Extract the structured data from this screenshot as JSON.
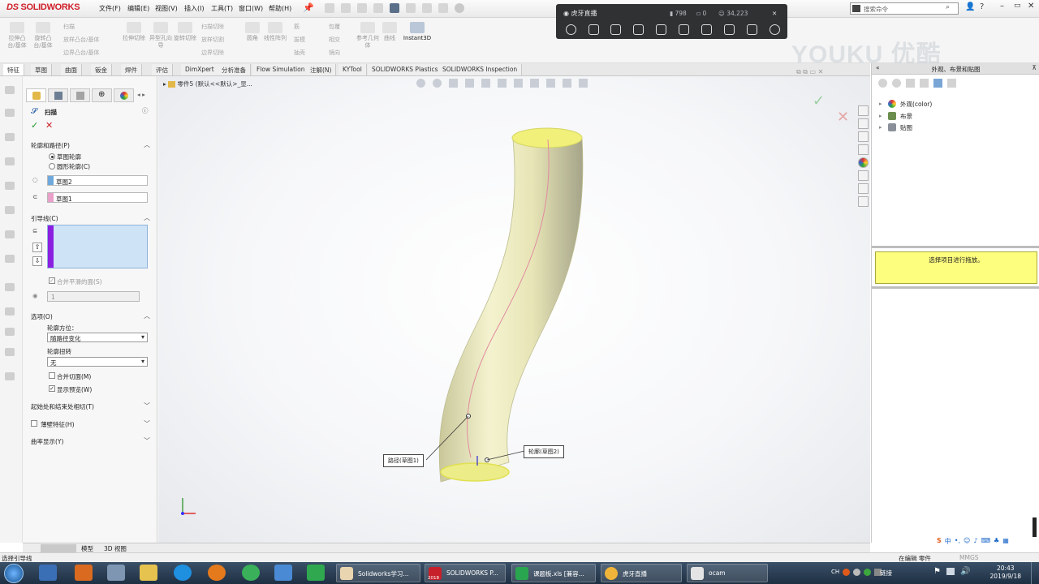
{
  "app": {
    "logo_prefix": "DS",
    "logo_name": "SOLIDWORKS"
  },
  "menu": [
    "文件(F)",
    "编辑(E)",
    "视图(V)",
    "插入(I)",
    "工具(T)",
    "窗口(W)",
    "帮助(H)"
  ],
  "search": {
    "placeholder": "搜索命令"
  },
  "ribbon": {
    "large": [
      "拉伸凸台/基体",
      "旋转凸台/基体",
      "拉伸切除",
      "异型孔向导",
      "旋转切除",
      "圆角",
      "线性阵列",
      "参考几何体",
      "曲线",
      "Instant3D"
    ],
    "small": [
      "扫描",
      "放样凸台/基体",
      "边界凸台/基体",
      "扫描切除",
      "放样切割",
      "边界切除",
      "筋",
      "拔模",
      "抽壳",
      "包覆",
      "相交",
      "镜向"
    ]
  },
  "tabs": [
    "特征",
    "草图",
    "曲面",
    "钣金",
    "焊件",
    "评估",
    "DimXpert",
    "分析准备",
    "Flow Simulation",
    "注解(N)",
    "KYTool",
    "SOLIDWORKS Plastics",
    "SOLIDWORKS Inspection"
  ],
  "overlay": {
    "title": "虎牙直播",
    "viewers": "798",
    "likes": "0",
    "fans": "34,223"
  },
  "watermark": "YOUKU 优酷",
  "panel": {
    "feature_title": "扫描",
    "profile_path": {
      "header": "轮廓和路径(P)",
      "radio1": "草图轮廓",
      "radio2": "圆形轮廓(C)",
      "profile_value": "草图2",
      "path_value": "草图1"
    },
    "guides": {
      "header": "引导线(C)",
      "merge_faces": "合并平滑的面(S)",
      "spin_value": "1"
    },
    "options": {
      "header": "选项(O)",
      "orientation_label": "轮廓方位：",
      "orientation_value": "随路径变化",
      "twist_label": "轮廓扭转",
      "twist_value": "无",
      "merge_tangent": "合并切面(M)",
      "show_preview": "显示预览(W)"
    },
    "tangency": "起始处和结束处相切(T)",
    "thin": "薄壁特征(H)",
    "curvature": "曲率显示(Y)"
  },
  "viewport": {
    "doc_title": "零件5 (默认<<默认>_显...",
    "callout_path": "路径(草图1)",
    "callout_profile": "轮廓(草图2)"
  },
  "right_panel": {
    "header": "外观、布景和贴图",
    "tree": [
      "外观(color)",
      "布景",
      "贴图"
    ],
    "tip": "选择项目进行拖放。"
  },
  "bottom_tabs": [
    "模型",
    "3D 视图"
  ],
  "status": {
    "left": "选择引导线",
    "right": "在编辑 零件",
    "units": "MMGS"
  },
  "taskbar": {
    "buttons": [
      "Solidworks学习...",
      "SOLIDWORKS P...",
      "课题板.xls [兼容...",
      "虎牙直播",
      "ocam"
    ],
    "sw_year": "2018",
    "time": "20:43",
    "date": "2019/9/18",
    "link": "链接",
    "lang": "CH"
  },
  "colors": {
    "accent": "#d0202a",
    "profile_swatch": "#6fa8dc",
    "path_swatch": "#e9a0c9",
    "guide_bar": "#8a1fe0",
    "tip_bg": "#fdfd7e",
    "part_color": "#e9e8b4"
  }
}
